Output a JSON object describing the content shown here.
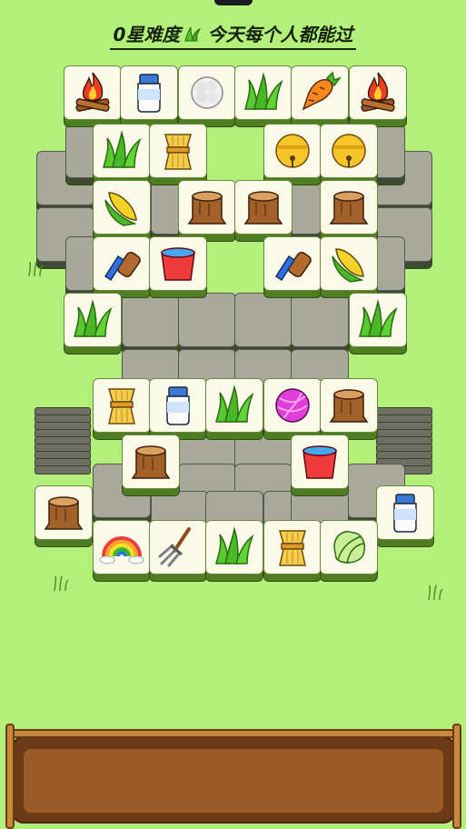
{
  "header": {
    "stars_label": "0星难度",
    "slogan": "今天每个人都能过"
  },
  "colors": {
    "background": "#b3ef7b",
    "tile_face": "#fbfae8",
    "tile_base": "#4f7d22",
    "tray_wood": "#6b3a15"
  },
  "icons": {
    "campfire": "campfire-icon",
    "milk": "milk-bottle-icon",
    "cotton": "cotton-icon",
    "grass": "grass-icon",
    "carrot": "carrot-icon",
    "wheat": "wheat-icon",
    "bell": "bell-icon",
    "corn": "corn-icon",
    "stump": "stump-icon",
    "brush": "brush-icon",
    "bucket": "bucket-icon",
    "yarn": "yarn-icon",
    "rainbow": "rainbow-icon",
    "pitchfork": "pitchfork-icon",
    "cabbage": "cabbage-icon"
  },
  "tray": {
    "slots_filled": 0
  }
}
